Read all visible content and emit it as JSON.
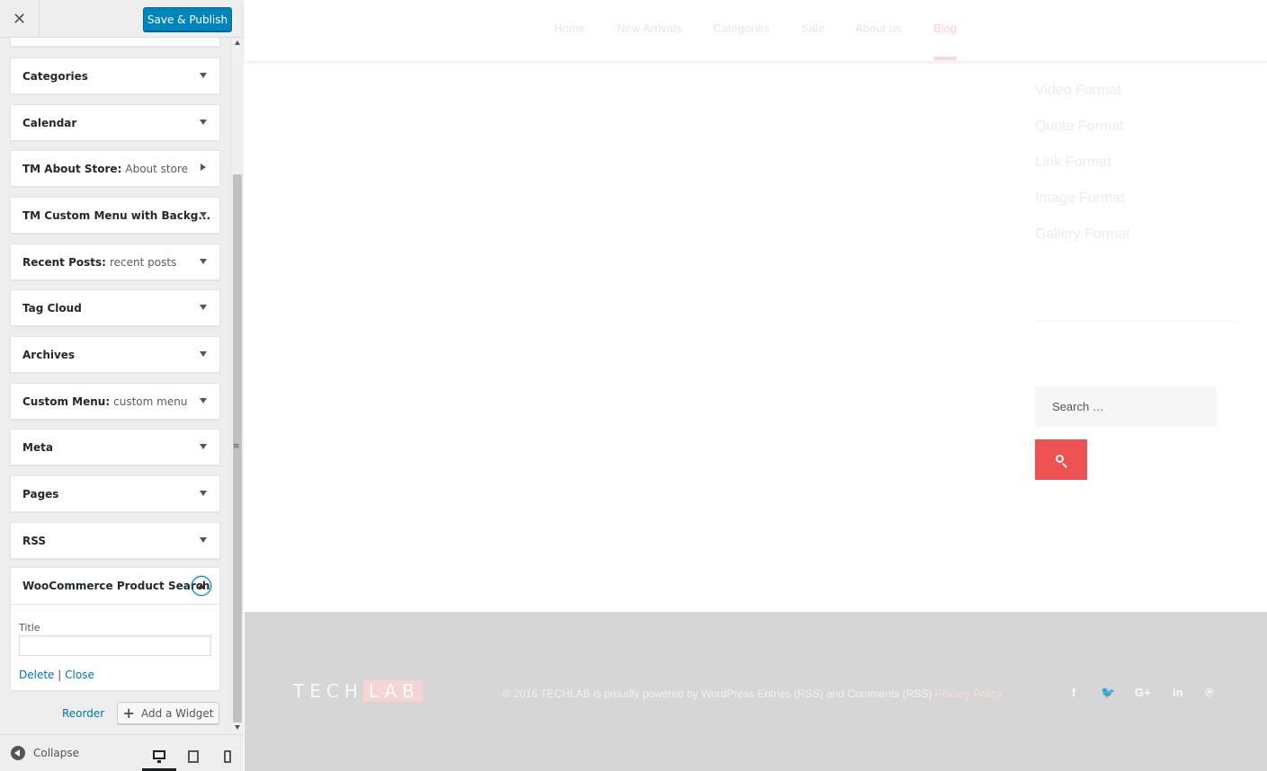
{
  "sidebar": {
    "close_glyph": "✕",
    "save_label": "Save & Publish",
    "widgets": [
      {
        "title": "Categories",
        "sub": ""
      },
      {
        "title": "Calendar",
        "sub": ""
      },
      {
        "title": "TM About Store:",
        "sub": "About store"
      },
      {
        "title": "TM Custom Menu with Backg...",
        "sub": ""
      },
      {
        "title": "Recent Posts:",
        "sub": "recent posts"
      },
      {
        "title": "Tag Cloud",
        "sub": ""
      },
      {
        "title": "Archives",
        "sub": ""
      },
      {
        "title": "Custom Menu:",
        "sub": "custom menu"
      },
      {
        "title": "Meta",
        "sub": ""
      },
      {
        "title": "Pages",
        "sub": ""
      },
      {
        "title": "RSS",
        "sub": ""
      }
    ],
    "expanded_widget": {
      "title": "WooCommerce Product Search",
      "field_label": "Title",
      "field_value": "",
      "delete_label": "Delete",
      "separator": "|",
      "close_label": "Close"
    },
    "reorder_label": "Reorder",
    "add_widget_label": "Add a Widget",
    "collapse_label": "Collapse",
    "icons": [
      "close-icon",
      "chevron-down-icon",
      "chevron-right-icon",
      "chevron-up-icon",
      "plus-icon",
      "collapse-arrow-icon",
      "desktop-icon",
      "tablet-icon",
      "mobile-icon"
    ]
  },
  "preview": {
    "nav": [
      "Home",
      "New Arrivals",
      "Categories",
      "Sale",
      "About us",
      "Blog"
    ],
    "active_nav": "Blog",
    "categories": [
      "Video Format",
      "Quote Format",
      "Link Format",
      "Image Format",
      "Gallery Format"
    ],
    "search_placeholder": "Search …",
    "footer": {
      "logo_left": "TECH",
      "logo_right": "LAB",
      "copyright": "© 2016 TECHLAB is proudly powered by WordPress Entries (RSS) and Comments (RSS)",
      "privacy": "Privacy Policy",
      "social": [
        "f",
        "🐦",
        "G+",
        "in",
        "℗"
      ]
    }
  },
  "colors": {
    "accent_blue": "#0085ba",
    "link_blue": "#0073aa",
    "search_button": "#ee5353",
    "footer_bg": "#d6d6d7"
  }
}
